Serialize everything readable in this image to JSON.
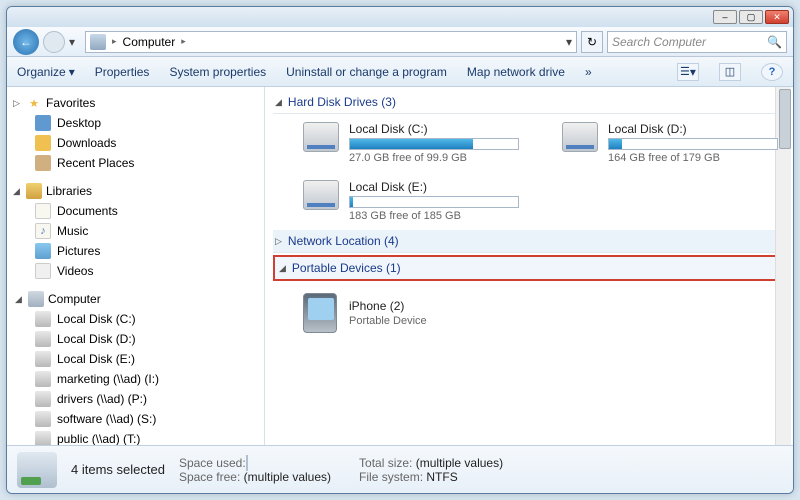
{
  "titlebar": {
    "min": "–",
    "max": "▢",
    "close": "✕"
  },
  "nav": {
    "address_root_sep": "▸",
    "location": "Computer",
    "sep2": "▸",
    "dropdown": "▾",
    "refresh_glyph": "↻",
    "search_placeholder": "Search Computer",
    "search_icon": "🔍"
  },
  "toolbar": {
    "organize": "Organize",
    "organize_drop": "▾",
    "properties": "Properties",
    "system_properties": "System properties",
    "uninstall": "Uninstall or change a program",
    "map_drive": "Map network drive",
    "more": "»",
    "view_drop": "▾",
    "help": "?"
  },
  "sidebar": {
    "favorites": {
      "label": "Favorites",
      "tw": "▷",
      "items": [
        {
          "label": "Desktop"
        },
        {
          "label": "Downloads"
        },
        {
          "label": "Recent Places"
        }
      ]
    },
    "libraries": {
      "label": "Libraries",
      "tw": "◢",
      "items": [
        {
          "label": "Documents"
        },
        {
          "label": "Music"
        },
        {
          "label": "Pictures"
        },
        {
          "label": "Videos"
        }
      ]
    },
    "computer": {
      "label": "Computer",
      "tw": "◢",
      "items": [
        {
          "label": "Local Disk (C:)"
        },
        {
          "label": "Local Disk (D:)"
        },
        {
          "label": "Local Disk (E:)"
        },
        {
          "label": "marketing (\\\\ad) (I:)"
        },
        {
          "label": "drivers (\\\\ad) (P:)"
        },
        {
          "label": "software (\\\\ad) (S:)"
        },
        {
          "label": "public (\\\\ad) (T:)"
        }
      ]
    }
  },
  "main": {
    "groups": {
      "hdd": {
        "tw": "◢",
        "label": "Hard Disk Drives (3)"
      },
      "net": {
        "tw": "▷",
        "label": "Network Location (4)"
      },
      "portable": {
        "tw": "◢",
        "label": "Portable Devices (1)"
      }
    },
    "drives": [
      {
        "name": "Local Disk (C:)",
        "free": "27.0 GB free of 99.9 GB",
        "fill_pct": 73
      },
      {
        "name": "Local Disk (D:)",
        "free": "164 GB free of 179 GB",
        "fill_pct": 8
      },
      {
        "name": "Local Disk (E:)",
        "free": "183 GB free of 185 GB",
        "fill_pct": 2
      }
    ],
    "device": {
      "name": "iPhone (2)",
      "sub": "Portable Device"
    }
  },
  "status": {
    "selected": "4 items selected",
    "space_used_label": "Space used:",
    "space_free_label": "Space free:",
    "space_free_value": "(multiple values)",
    "total_size_label": "Total size:",
    "total_size_value": "(multiple values)",
    "fs_label": "File system:",
    "fs_value": "NTFS"
  }
}
